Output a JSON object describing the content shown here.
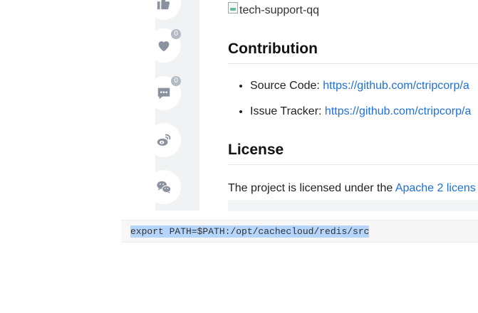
{
  "colors": {
    "link": "#1e6fd9",
    "selection": "#b5d5fb",
    "icon": "#8a919f"
  },
  "actions": [
    {
      "name": "like",
      "icon": "thumbs-up-icon"
    },
    {
      "name": "favorite",
      "icon": "heart-icon",
      "count": "0"
    },
    {
      "name": "comment",
      "icon": "comment-icon",
      "count": "0"
    },
    {
      "name": "weibo",
      "icon": "weibo-icon"
    },
    {
      "name": "wechat",
      "icon": "wechat-icon"
    }
  ],
  "article": {
    "broken_image_alt": "tech-support-qq",
    "contribution": {
      "heading": "Contribution",
      "items": [
        {
          "label": "Source Code: ",
          "link": "https://github.com/ctripcorp/a"
        },
        {
          "label": "Issue Tracker: ",
          "link": "https://github.com/ctripcorp/a"
        }
      ]
    },
    "license": {
      "heading": "License",
      "text": "The project is licensed under the ",
      "link": "Apache 2 licens"
    }
  },
  "code": {
    "line": "export PATH=$PATH:/opt/cachecloud/redis/src"
  }
}
